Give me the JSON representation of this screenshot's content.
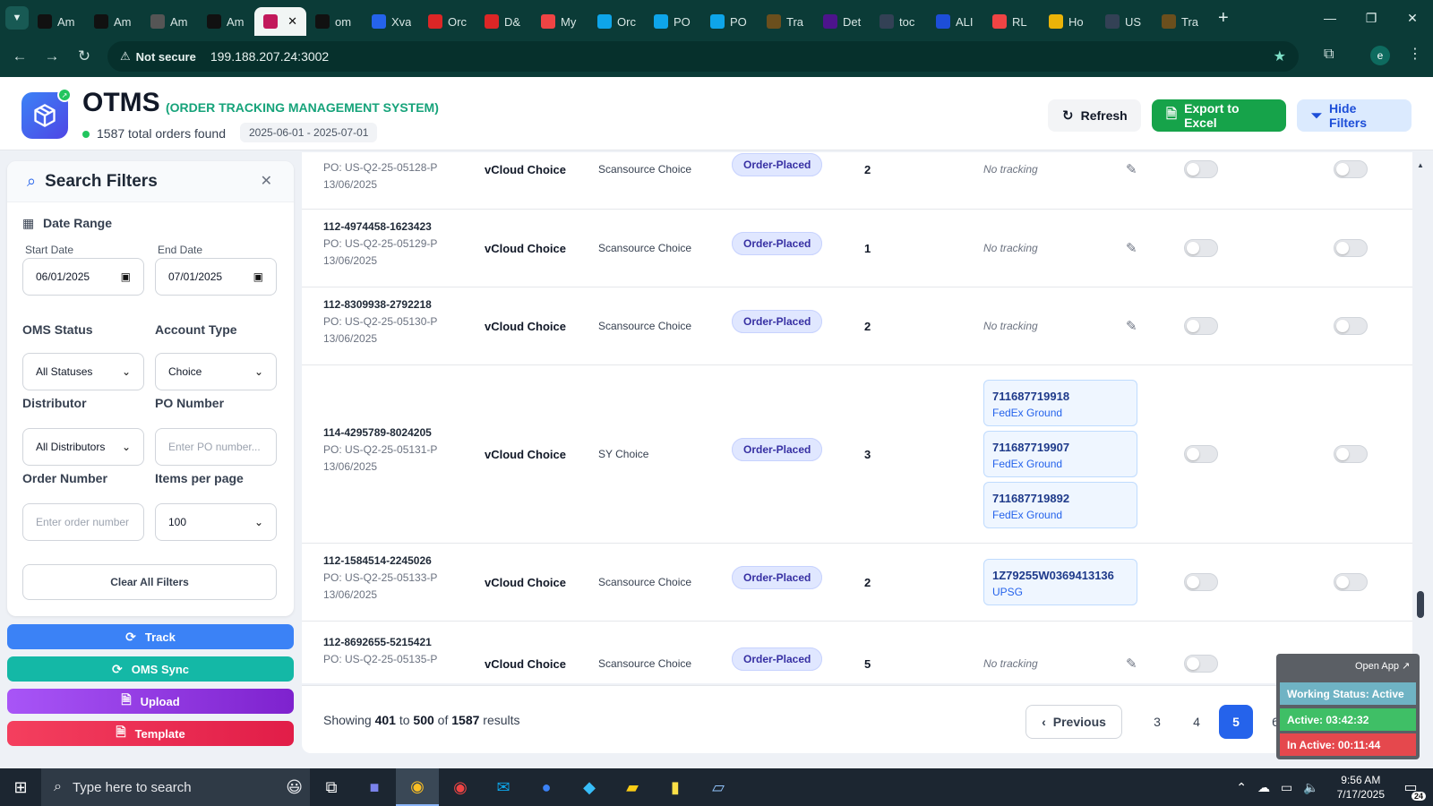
{
  "browser": {
    "tabs": [
      {
        "label": "Am",
        "icon": "amazon-icon",
        "bg": "#111111"
      },
      {
        "label": "Am",
        "icon": "amazon-icon",
        "bg": "#111111"
      },
      {
        "label": "Am",
        "icon": "amazon-icon",
        "bg": "#555555"
      },
      {
        "label": "Am",
        "icon": "amazon-icon",
        "bg": "#111111"
      },
      {
        "label": "",
        "icon": "otms-icon",
        "bg": "#c2185b",
        "active": true
      },
      {
        "label": "om",
        "icon": "om-icon",
        "bg": "#111111"
      },
      {
        "label": "Xva",
        "icon": "xva-icon",
        "bg": "#2563eb"
      },
      {
        "label": "Orc",
        "icon": "orc-icon",
        "bg": "#dc2626"
      },
      {
        "label": "D&",
        "icon": "dh-icon",
        "bg": "#dc2626"
      },
      {
        "label": "My",
        "icon": "my-icon",
        "bg": "#ef4444"
      },
      {
        "label": "Orc",
        "icon": "ec-icon",
        "bg": "#0ea5e9"
      },
      {
        "label": "PO",
        "icon": "ec-icon",
        "bg": "#0ea5e9"
      },
      {
        "label": "PO",
        "icon": "ec-icon",
        "bg": "#0ea5e9"
      },
      {
        "label": "Tra",
        "icon": "ups-icon",
        "bg": "#6b4f1d"
      },
      {
        "label": "Det",
        "icon": "fedex-icon",
        "bg": "#4d148c"
      },
      {
        "label": "toc",
        "icon": "toc-icon",
        "bg": "#334155"
      },
      {
        "label": "ALI",
        "icon": "ali-icon",
        "bg": "#1d4ed8"
      },
      {
        "label": "RL",
        "icon": "rl-icon",
        "bg": "#ef4444"
      },
      {
        "label": "Ho",
        "icon": "ho-icon",
        "bg": "#eab308"
      },
      {
        "label": "US",
        "icon": "us-icon",
        "bg": "#334155"
      },
      {
        "label": "Tra",
        "icon": "ups-icon",
        "bg": "#6b4f1d"
      }
    ],
    "not_secure": "Not secure",
    "url": "199.188.207.24:3002",
    "profile_initial": "e"
  },
  "header": {
    "title": "OTMS",
    "subtitle": "(ORDER TRACKING MANAGEMENT SYSTEM)",
    "orders_found": "1587 total orders found",
    "date_range": "2025-06-01 - 2025-07-01",
    "refresh_label": "Refresh",
    "export_label": "Export to Excel",
    "hide_filters_label": "Hide Filters"
  },
  "filters": {
    "title": "Search Filters",
    "date_range_label": "Date Range",
    "start_date_label": "Start Date",
    "start_date_value": "06/01/2025",
    "end_date_label": "End Date",
    "end_date_value": "07/01/2025",
    "oms_status_label": "OMS Status",
    "oms_status_value": "All Statuses",
    "account_type_label": "Account Type",
    "account_type_value": "Choice",
    "distributor_label": "Distributor",
    "distributor_value": "All Distributors",
    "po_number_label": "PO Number",
    "po_number_placeholder": "Enter PO number...",
    "order_number_label": "Order Number",
    "order_number_placeholder": "Enter order number",
    "items_per_page_label": "Items per page",
    "items_per_page_value": "100",
    "clear_label": "Clear All Filters"
  },
  "actions": {
    "track": "Track",
    "oms_sync": "OMS Sync",
    "upload": "Upload",
    "template": "Template"
  },
  "rows": [
    {
      "order": "",
      "po": "PO: US-Q2-25-05128-P",
      "date": "13/06/2025",
      "account": "vCloud Choice",
      "distributor": "Scansource Choice",
      "status": "Order-Placed",
      "qty": "2",
      "tracking": "No tracking",
      "trackings": []
    },
    {
      "order": "112-4974458-1623423",
      "po": "PO: US-Q2-25-05129-P",
      "date": "13/06/2025",
      "account": "vCloud Choice",
      "distributor": "Scansource Choice",
      "status": "Order-Placed",
      "qty": "1",
      "tracking": "No tracking",
      "trackings": []
    },
    {
      "order": "112-8309938-2792218",
      "po": "PO: US-Q2-25-05130-P",
      "date": "13/06/2025",
      "account": "vCloud Choice",
      "distributor": "Scansource Choice",
      "status": "Order-Placed",
      "qty": "2",
      "tracking": "No tracking",
      "trackings": []
    },
    {
      "order": "114-4295789-8024205",
      "po": "PO: US-Q2-25-05131-P",
      "date": "13/06/2025",
      "account": "vCloud Choice",
      "distributor": "SY Choice",
      "status": "Order-Placed",
      "qty": "3",
      "tracking": "",
      "trackings": [
        {
          "number": "711687719918",
          "carrier": "FedEx Ground"
        },
        {
          "number": "711687719907",
          "carrier": "FedEx Ground"
        },
        {
          "number": "711687719892",
          "carrier": "FedEx Ground"
        }
      ]
    },
    {
      "order": "112-1584514-2245026",
      "po": "PO: US-Q2-25-05133-P",
      "date": "13/06/2025",
      "account": "vCloud Choice",
      "distributor": "Scansource Choice",
      "status": "Order-Placed",
      "qty": "2",
      "tracking": "",
      "trackings": [
        {
          "number": "1Z79255W0369413136",
          "carrier": "UPSG"
        }
      ]
    },
    {
      "order": "112-8692655-5215421",
      "po": "PO: US-Q2-25-05135-P",
      "date": "",
      "account": "vCloud Choice",
      "distributor": "Scansource Choice",
      "status": "Order-Placed",
      "qty": "5",
      "tracking": "No tracking",
      "trackings": []
    }
  ],
  "pagination": {
    "prefix": "Showing",
    "from": "401",
    "to_word": "to",
    "to": "500",
    "of_word": "of",
    "total": "1587",
    "suffix": "results",
    "previous_label": "Previous",
    "pages": [
      "3",
      "4",
      "5",
      "6"
    ],
    "current_page": "5"
  },
  "widget": {
    "open_app": "Open App ↗",
    "working_status": "Working Status: Active",
    "active": "Active: 03:42:32",
    "inactive": "In Active: 00:11:44"
  },
  "taskbar": {
    "search_placeholder": "Type here to search",
    "time": "9:56 AM",
    "date": "7/17/2025",
    "notifications": "24"
  }
}
